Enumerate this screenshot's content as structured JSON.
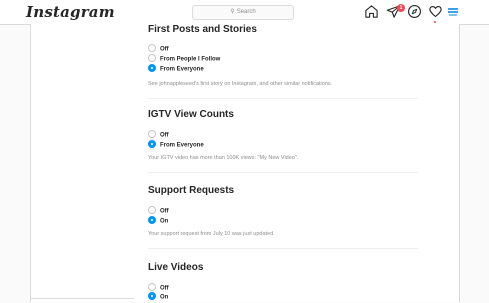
{
  "topbar": {
    "logo": "Instagram",
    "search_placeholder": "Search",
    "notification_count": "1"
  },
  "sections": [
    {
      "title": "First Posts and Stories",
      "options": [
        {
          "label": "Off",
          "selected": false
        },
        {
          "label": "From People I Follow",
          "selected": false
        },
        {
          "label": "From Everyone",
          "selected": true
        }
      ],
      "note": "See johnappleseed's first story on Instagram, and other similar notifications."
    },
    {
      "title": "IGTV View Counts",
      "options": [
        {
          "label": "Off",
          "selected": false
        },
        {
          "label": "From Everyone",
          "selected": true
        }
      ],
      "note": "Your IGTV video has more than 100K views: \"My New Video\"."
    },
    {
      "title": "Support Requests",
      "options": [
        {
          "label": "Off",
          "selected": false
        },
        {
          "label": "On",
          "selected": true
        }
      ],
      "note": "Your support request from July 10 was just updated."
    },
    {
      "title": "Live Videos",
      "options": [
        {
          "label": "Off",
          "selected": false
        },
        {
          "label": "On",
          "selected": true
        }
      ]
    }
  ],
  "colors": {
    "accent": "#0095f6",
    "badge": "#ed4956",
    "border": "#dbdbdb",
    "muted_text": "#8e8e8e"
  }
}
